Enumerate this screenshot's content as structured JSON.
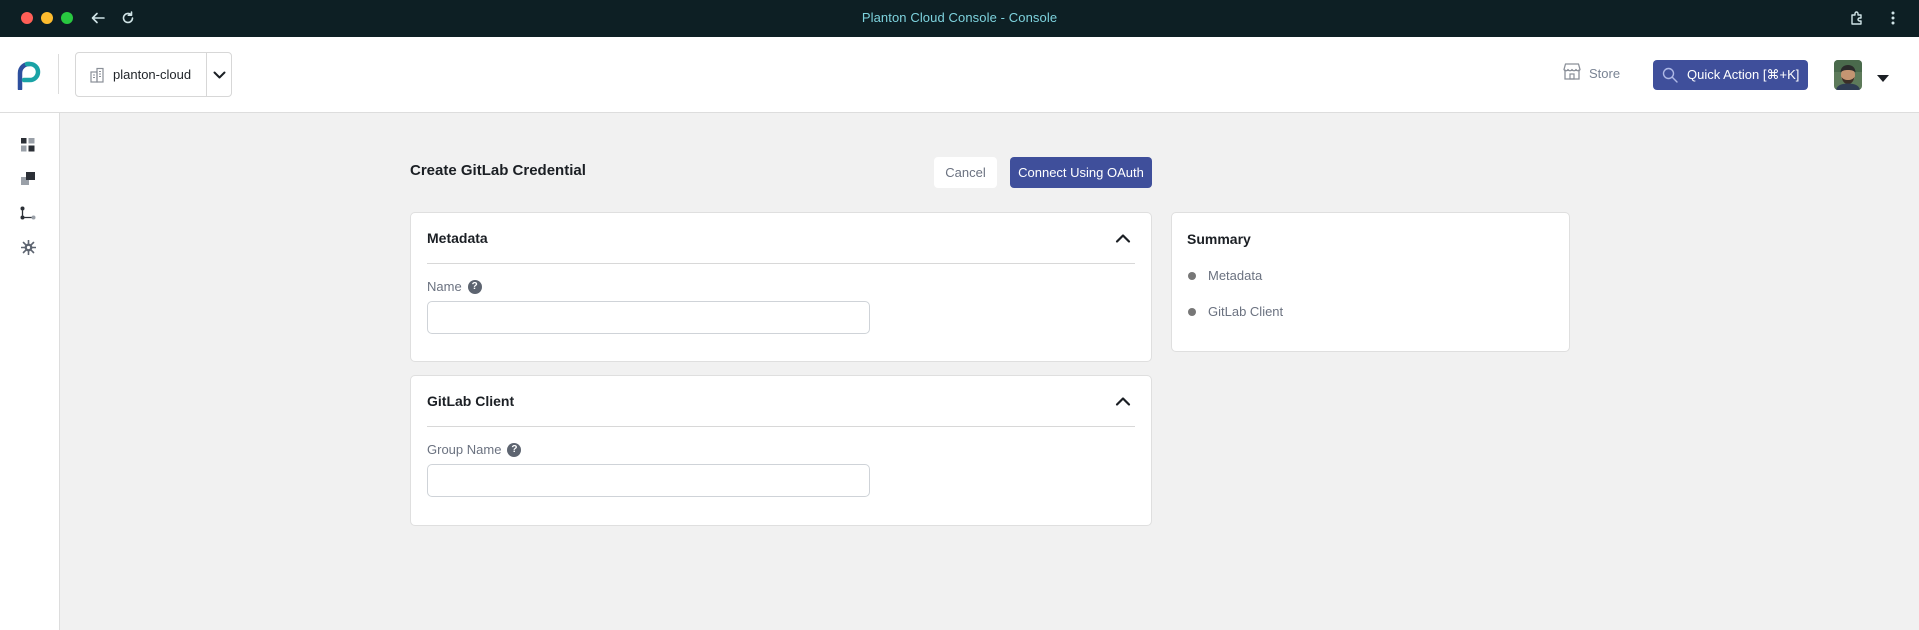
{
  "window": {
    "title": "Planton Cloud Console - Console"
  },
  "header": {
    "org_name": "planton-cloud",
    "store_label": "Store",
    "quick_action_label": "Quick Action [⌘+K]"
  },
  "rail": {
    "icons": [
      "dashboard-icon",
      "stack-icon",
      "pipeline-icon",
      "settings-icon"
    ]
  },
  "page": {
    "title": "Create GitLab Credential",
    "cancel_label": "Cancel",
    "oauth_label": "Connect Using OAuth"
  },
  "sections": {
    "metadata": {
      "title": "Metadata",
      "field_label": "Name",
      "field_value": ""
    },
    "gitlab": {
      "title": "GitLab Client",
      "field_label": "Group Name",
      "field_value": ""
    }
  },
  "summary": {
    "title": "Summary",
    "items": [
      "Metadata",
      "GitLab Client"
    ]
  },
  "colors": {
    "accent": "#3f4f9b",
    "titlebar": "#0d1f24",
    "title_text": "#7ed3de",
    "logo_teal": "#1aa3a6",
    "logo_blue": "#2d4f9e"
  }
}
